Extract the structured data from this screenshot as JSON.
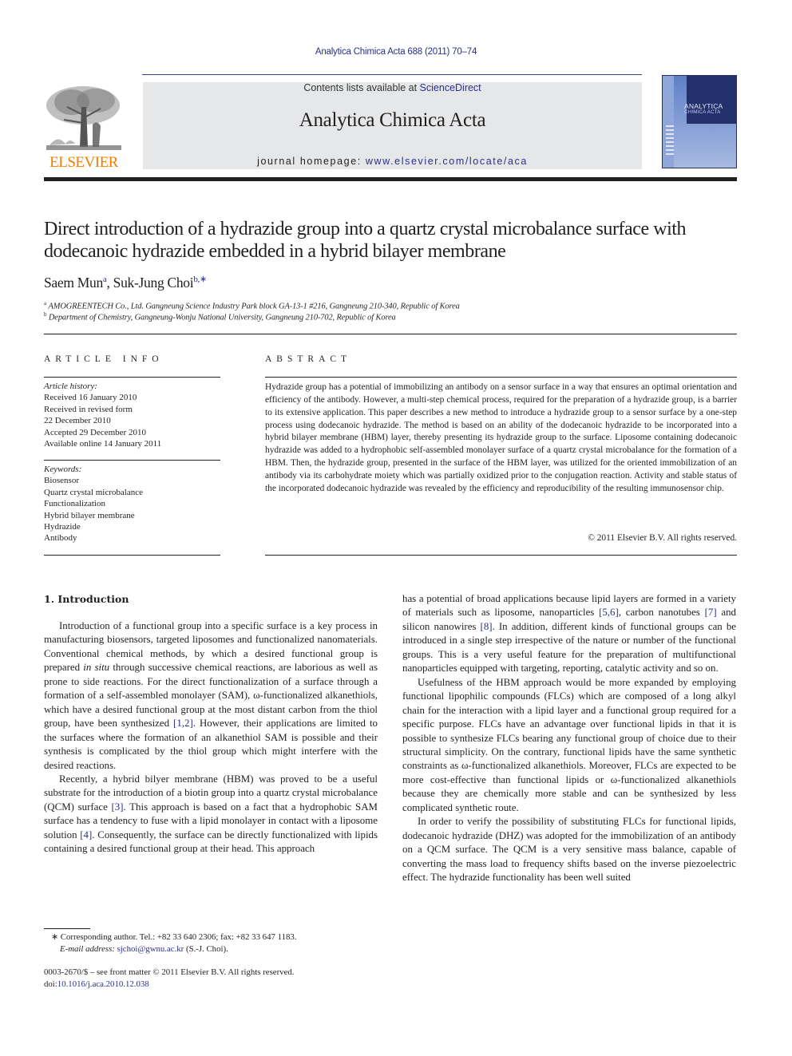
{
  "running_head": "Analytica Chimica Acta 688 (2011) 70–74",
  "publisher": {
    "logo_icon": "elsevier-tree-logo-icon",
    "logo_word": "ELSEVIER",
    "brand_color": "#f07d00"
  },
  "banner": {
    "contents_prefix": "Contents lists available at ",
    "contents_link": "ScienceDirect",
    "journal_title": "Analytica Chimica Acta",
    "homepage_prefix": "journal homepage: ",
    "homepage_link": "www.elsevier.com/locate/aca",
    "background_color": "#e6e7e8",
    "link_color": "#2b2f8f"
  },
  "cover": {
    "icon": "journal-cover-thumbnail-icon",
    "title_line1": "ANALYTICA",
    "title_line2": "CHIMICA ACTA"
  },
  "article": {
    "title": "Direct introduction of a hydrazide group into a quartz crystal microbalance surface with dodecanoic hydrazide embedded in a hybrid bilayer membrane",
    "authors": [
      {
        "name": "Saem Mun",
        "sup": "a"
      },
      {
        "name": "Suk-Jung Choi",
        "sup": "b,∗"
      }
    ],
    "author_separator": ", ",
    "affiliations": [
      {
        "sup": "a",
        "text": "AMOGREENTECH Co., Ltd. Gangneung Science Industry Park block GA-13-1 #216, Gangneung 210-340, Republic of Korea"
      },
      {
        "sup": "b",
        "text": "Department of Chemistry, Gangneung-Wonju National University, Gangneung 210-702, Republic of Korea"
      }
    ]
  },
  "article_info": {
    "heading": "ARTICLE INFO",
    "history_label": "Article history:",
    "history": [
      "Received 16 January 2010",
      "Received in revised form",
      "22 December 2010",
      "Accepted 29 December 2010",
      "Available online 14 January 2011"
    ],
    "keywords_label": "Keywords:",
    "keywords": [
      "Biosensor",
      "Quartz crystal microbalance",
      "Functionalization",
      "Hybrid bilayer membrane",
      "Hydrazide",
      "Antibody"
    ]
  },
  "abstract": {
    "heading": "ABSTRACT",
    "text": "Hydrazide group has a potential of immobilizing an antibody on a sensor surface in a way that ensures an optimal orientation and efficiency of the antibody. However, a multi-step chemical process, required for the preparation of a hydrazide group, is a barrier to its extensive application. This paper describes a new method to introduce a hydrazide group to a sensor surface by a one-step process using dodecanoic hydrazide. The method is based on an ability of the dodecanoic hydrazide to be incorporated into a hybrid bilayer membrane (HBM) layer, thereby presenting its hydrazide group to the surface. Liposome containing dodecanoic hydrazide was added to a hydrophobic self-assembled monolayer surface of a quartz crystal microbalance for the formation of a HBM. Then, the hydrazide group, presented in the surface of the HBM layer, was utilized for the oriented immobilization of an antibody via its carbohydrate moiety which was partially oxidized prior to the conjugation reaction. Activity and stable status of the incorporated dodecanoic hydrazide was revealed by the efficiency and reproducibility of the resulting immunosensor chip.",
    "copyright": "© 2011 Elsevier B.V. All rights reserved."
  },
  "introduction": {
    "heading": "1.  Introduction",
    "p1": {
      "a": "Introduction of a functional group into a specific surface is a key process in manufacturing biosensors, targeted liposomes and functionalized nanomaterials. Conventional chemical methods, by which a desired functional group is prepared ",
      "em": "in situ",
      "b": " through successive chemical reactions, are laborious as well as prone to side reactions. For the direct functionalization of a surface through a formation of a self-assembled monolayer (SAM), ω-functionalized alkanethiols, which have a desired functional group at the most distant carbon from the thiol group, have been synthesized ",
      "ref1": "[1,2]",
      "c": ". However, their applications are limited to the surfaces where the formation of an alkanethiol SAM is possible and their synthesis is complicated by the thiol group which might interfere with the desired reactions."
    },
    "p2": {
      "a": "Recently, a hybrid bilyer membrane (HBM) was proved to be a useful substrate for the introduction of a biotin group into a quartz crystal microbalance (QCM) surface ",
      "ref1": "[3]",
      "b": ". This approach is based on a fact that a hydrophobic SAM surface has a tendency to fuse with a lipid monolayer in contact with a liposome solution ",
      "ref2": "[4]",
      "c": ". Consequently, the surface can be directly functionalized with lipids containing a desired functional group at their head. This approach"
    },
    "p2_cont": {
      "a": "has a potential of broad applications because lipid layers are formed in a variety of materials such as liposome, nanoparticles ",
      "ref1": "[5,6]",
      "b": ", carbon nanotubes ",
      "ref2": "[7]",
      "c": " and silicon nanowires ",
      "ref3": "[8]",
      "d": ". In addition, different kinds of functional groups can be introduced in a single step irrespective of the nature or number of the functional groups. This is a very useful feature for the preparation of multifunctional nanoparticles equipped with targeting, reporting, catalytic activity and so on."
    },
    "p3": "Usefulness of the HBM approach would be more expanded by employing functional lipophilic compounds (FLCs) which are composed of a long alkyl chain for the interaction with a lipid layer and a functional group required for a specific purpose. FLCs have an advantage over functional lipids in that it is possible to synthesize FLCs bearing any functional group of choice due to their structural simplicity. On the contrary, functional lipids have the same synthetic constraints as ω-functionalized alkanethiols. Moreover, FLCs are expected to be more cost-effective than functional lipids or ω-functionalized alkanethiols because they are chemically more stable and can be synthesized by less complicated synthetic route.",
    "p4": "In order to verify the possibility of substituting FLCs for functional lipids, dodecanoic hydrazide (DHZ) was adopted for the immobilization of an antibody on a QCM surface. The QCM is a very sensitive mass balance, capable of converting the mass load to frequency shifts based on the inverse piezoelectric effect. The hydrazide functionality has been well suited"
  },
  "footnotes": {
    "corresponding": "∗  Corresponding author. Tel.: +82 33 640 2306; fax: +82 33 647 1183.",
    "email_label": "E-mail address: ",
    "email": "sjchoi@gwnu.ac.kr",
    "email_suffix": " (S.-J. Choi).",
    "front_matter": "0003-2670/$ – see front matter © 2011 Elsevier B.V. All rights reserved.",
    "doi_prefix": "doi:",
    "doi": "10.1016/j.aca.2010.12.038"
  }
}
